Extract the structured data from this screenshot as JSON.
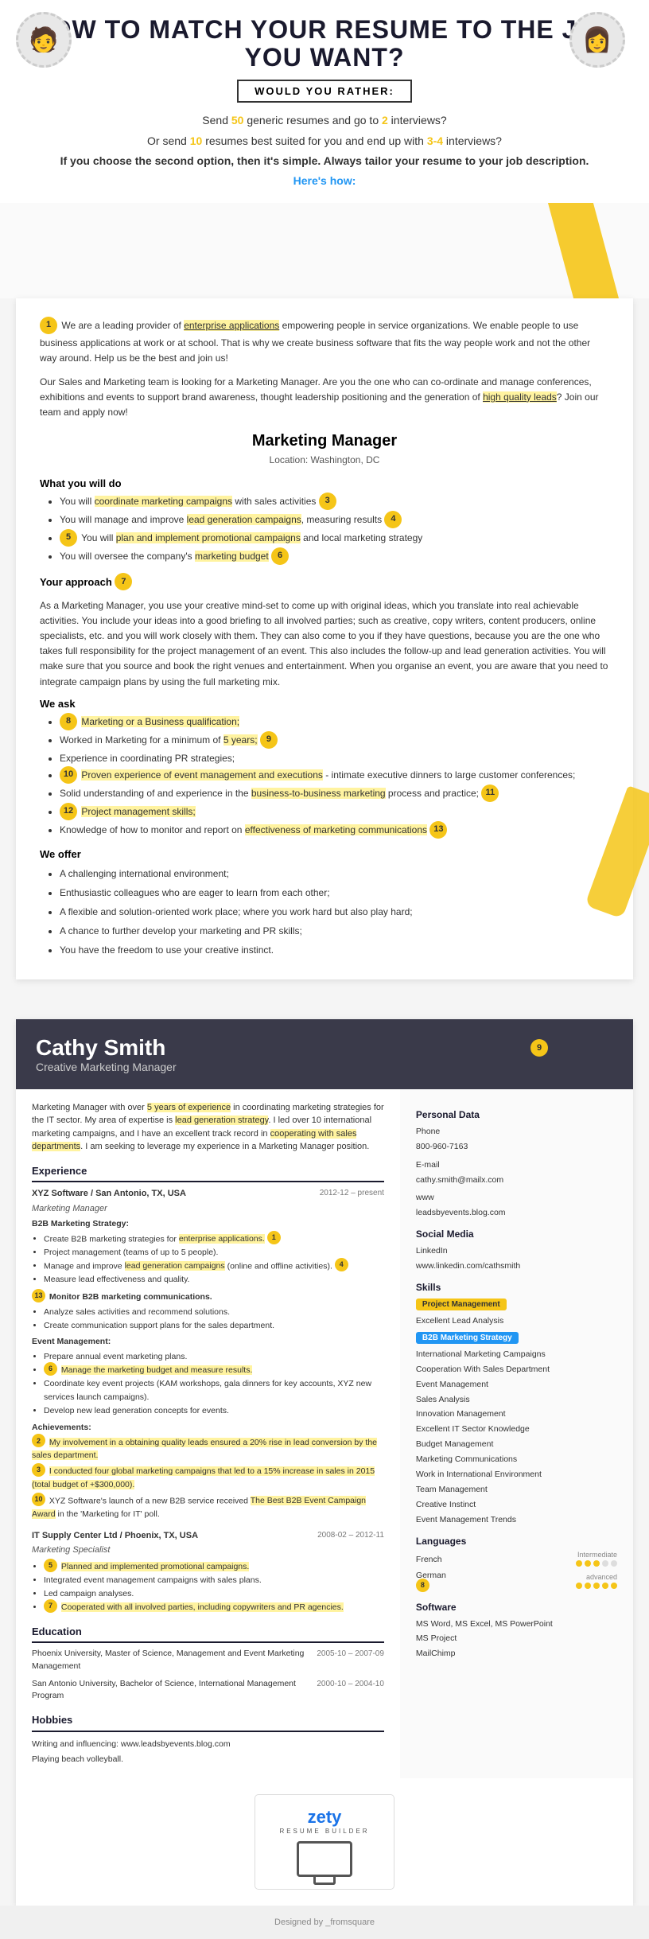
{
  "header": {
    "title": "HOW TO MATCH YOUR RESUME TO THE JOB YOU WANT?",
    "would_you_rather": "WOULD YOU RATHER:",
    "line1": "Send 50 generic resumes and go to 2 interviews?",
    "line2": "Or send 10 resumes best suited for you and end up with 3-4 interviews?",
    "line3": "If you choose the second option, then it's simple. Always tailor your resume to your job description.",
    "line4": "Here's how:"
  },
  "job_description": {
    "intro1": "We are a leading provider of enterprise applications empowering people in service organizations. We enable people to use business applications at work or at school. That is why we create business software that fits the way people work and not the other way around. Help us be the best and join us!",
    "intro2": "Our Sales and Marketing team is looking for a Marketing Manager. Are you the one who can co-ordinate and manage conferences, exhibitions and events to support brand awareness, thought leadership positioning and the generation of high quality leads? Join our team and apply now!",
    "title": "Marketing Manager",
    "location": "Location: Washington, DC",
    "what_you_will_do": "What you will do",
    "tasks": [
      "You will coordinate marketing campaigns with sales activities",
      "You will manage and improve lead generation campaigns, measuring results",
      "You will plan and implement promotional campaigns and local marketing strategy",
      "You will oversee the company's marketing budget"
    ],
    "your_approach": "Your approach",
    "approach_text": "As a Marketing Manager, you use your creative mind-set to come up with original ideas, which you translate into real achievable activities. You include your ideas into a good briefing to all involved parties; such as creative, copy writers, content producers, online specialists, etc. and you will work closely with them. They can also come to you if they have questions, because you are the one who takes full responsibility for the project management of an event. This also includes the follow-up and lead generation activities. You will make sure that you source and book the right venues and entertainment. When you organise an event, you are aware that you need to integrate campaign plans by using the full marketing mix.",
    "we_ask": "We ask",
    "requirements": [
      "Marketing or a Business qualification;",
      "Worked in Marketing for a minimum of 5 years;",
      "Experience in coordinating PR strategies;",
      "Proven experience of event management and executions - intimate executive dinners to large customer conferences;",
      "Solid understanding of and experience in the business-to-business marketing process and practice;",
      "Project management skills;",
      "Knowledge of how to monitor and report on effectiveness of marketing communications"
    ],
    "we_offer": "We offer",
    "offer_items": [
      "A challenging international environment;",
      "Enthusiastic colleagues who are eager to learn from each other;",
      "A flexible and solution-oriented work place; where you work hard but also play hard;",
      "A chance to further develop your marketing and PR skills;",
      "You have the freedom to use your creative instinct."
    ]
  },
  "resume": {
    "name": "Cathy Smith",
    "title": "Creative Marketing Manager",
    "intro": "Marketing Manager with over 5 years of experience in coordinating marketing strategies for the IT sector. My area of expertise is lead generation strategy. I led over 10 international marketing campaigns, and I have an excellent track record in cooperating with sales departments. I am seeking to leverage my experience in a Marketing Manager position.",
    "sections": {
      "experience_label": "Experience",
      "education_label": "Education",
      "hobbies_label": "Hobbies"
    },
    "jobs": [
      {
        "period": "2012-12 – present",
        "company": "XYZ Software / San Antonio, TX, USA",
        "role": "Marketing Manager",
        "subsections": [
          {
            "label": "B2B Marketing Strategy:",
            "items": [
              "Create B2B marketing strategies for enterprise applications.",
              "Project management (teams of up to 5 people).",
              "Manage and improve lead generation campaigns (online and offline activities).",
              "Measure lead effectiveness and quality."
            ]
          },
          {
            "label": "Monitor B2B marketing communications.",
            "items": [
              "Analyze sales activities and recommend solutions.",
              "Create communication support plans for the sales department."
            ]
          },
          {
            "label": "Event Management:",
            "items": [
              "Prepare annual event marketing plans.",
              "Manage the marketing budget and measure results.",
              "Coordinate key event projects (KAM workshops, gala dinners for key accounts, XYZ new services launch campaigns).",
              "Develop new lead generation concepts for events."
            ]
          }
        ],
        "achievements_label": "Achievements:",
        "achievements": [
          "My involvement in a obtaining quality leads ensured a 20% rise in lead conversion by the sales department.",
          "I conducted four global marketing campaigns that led to a 15% increase in sales in 2015 (total budget of +$300,000).",
          "XYZ Software's launch of a new B2B service received The Best B2B Event Campaign Award in the 'Marketing for IT' poll."
        ]
      },
      {
        "period": "2008-02 – 2012-11",
        "company": "IT Supply Center Ltd / Phoenix, TX, USA",
        "role": "Marketing Specialist",
        "items": [
          "Planned and implemented promotional campaigns.",
          "Integrated event management campaigns with sales plans.",
          "Led campaign analyses.",
          "Cooperated with all involved parties, including copywriters and PR agencies."
        ]
      }
    ],
    "education": [
      {
        "period": "2005-10 – 2007-09",
        "school": "Phoenix University, Master of Science, Management and Event Marketing Management"
      },
      {
        "period": "2000-10 – 2004-10",
        "school": "San Antonio University, Bachelor of Science, International Management Program"
      }
    ],
    "hobbies": [
      "Writing and influencing: www.leadsbyevents.blog.com",
      "Playing beach volleyball."
    ],
    "personal_data": {
      "label": "Personal Data",
      "phone_label": "Phone",
      "phone": "800-960-7163",
      "email_label": "E-mail",
      "email": "cathy.smith@mailx.com",
      "www_label": "www",
      "www": "leadsbyevents.blog.com"
    },
    "social_media": {
      "label": "Social Media",
      "linkedin_label": "LinkedIn",
      "linkedin": "www.linkedin.com/cathsmith"
    },
    "skills": {
      "label": "Skills",
      "items": [
        {
          "name": "Project Management",
          "badge": "yellow"
        },
        {
          "name": "Excellent Lead Analysis",
          "badge": "none"
        },
        {
          "name": "B2B Marketing Strategy",
          "badge": "blue"
        },
        {
          "name": "International Marketing Campaigns",
          "badge": "none"
        },
        {
          "name": "Cooperation With Sales Department",
          "badge": "none"
        },
        {
          "name": "Event Management",
          "badge": "none"
        },
        {
          "name": "Sales Analysis",
          "badge": "none"
        },
        {
          "name": "Innovation Management",
          "badge": "none"
        },
        {
          "name": "Excellent IT Sector Knowledge",
          "badge": "none"
        },
        {
          "name": "Budget Management",
          "badge": "none"
        },
        {
          "name": "Marketing Communications",
          "badge": "none"
        },
        {
          "name": "Work in International Environment",
          "badge": "none"
        },
        {
          "name": "Team Management",
          "badge": "none"
        },
        {
          "name": "Creative Instinct",
          "badge": "none"
        },
        {
          "name": "Event Management Trends",
          "badge": "none"
        }
      ]
    },
    "languages": {
      "label": "Languages",
      "items": [
        {
          "name": "French",
          "level": "intermediate",
          "dots": 3
        },
        {
          "name": "German",
          "level": "advanced",
          "dots": 5
        }
      ]
    },
    "software": {
      "label": "Software",
      "items": [
        "MS Word, MS Excel, MS PowerPoint",
        "MS Project",
        "MailChimp"
      ]
    }
  },
  "footer": {
    "zety_label": "zety",
    "zety_sub": "RESUME BUILDER",
    "designed_by": "Designed by _fromsquare"
  },
  "circle_labels": [
    "1",
    "2",
    "3",
    "4",
    "5",
    "6",
    "7",
    "8",
    "9",
    "10",
    "11",
    "12",
    "13"
  ]
}
